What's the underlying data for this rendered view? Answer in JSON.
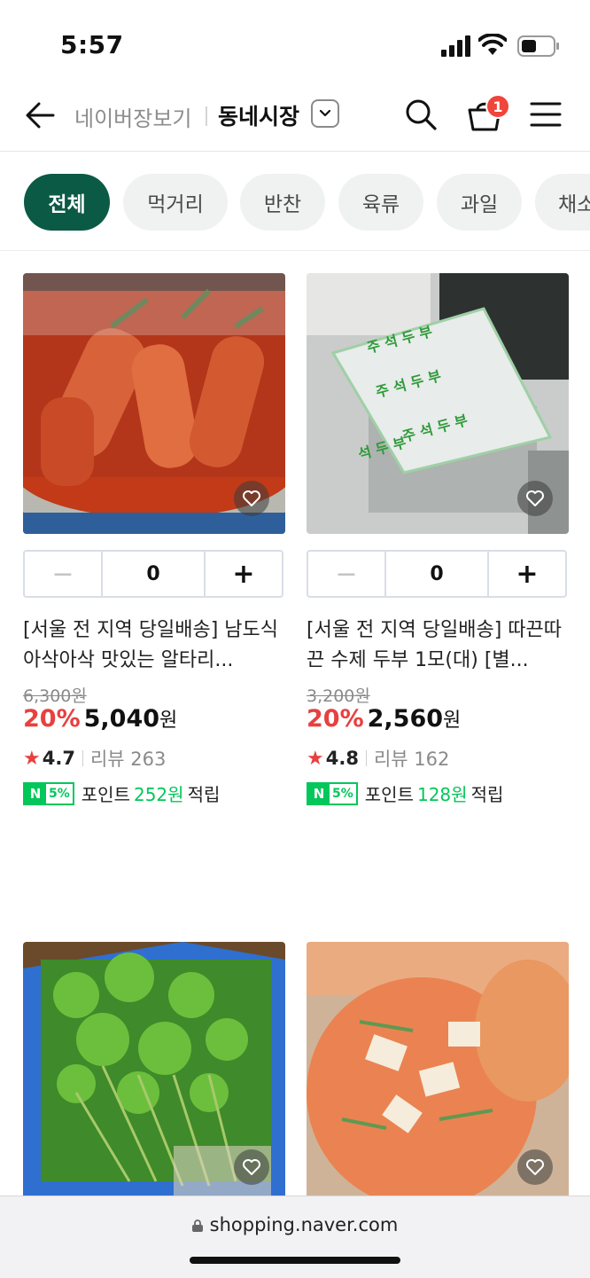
{
  "status": {
    "time": "5:57"
  },
  "header": {
    "brand": "네이버장보기",
    "market": "동네시장",
    "cart_count": "1"
  },
  "chips": [
    "전체",
    "먹거리",
    "반찬",
    "육류",
    "과일",
    "채소"
  ],
  "products": [
    {
      "title": "[서울 전 지역 당일배송] 남도식 아삭아삭 맛있는 알타리...",
      "qty": "0",
      "orig_price": "6,300원",
      "discount": "20%",
      "price": "5,040",
      "won": "원",
      "rating": "4.7",
      "review": "리뷰 263",
      "point_prefix": "포인트",
      "point": "252원",
      "point_suffix": "적립",
      "n_label": "N",
      "pct_label": "5%"
    },
    {
      "title": "[서울 전 지역 당일배송] 따끈따끈 수제 두부 1모(대) [별...",
      "qty": "0",
      "orig_price": "3,200원",
      "discount": "20%",
      "price": "2,560",
      "won": "원",
      "rating": "4.8",
      "review": "리뷰 162",
      "point_prefix": "포인트",
      "point": "128원",
      "point_suffix": "적립",
      "n_label": "N",
      "pct_label": "5%"
    }
  ],
  "url": "shopping.naver.com",
  "colors": {
    "accent": "#0b5a45",
    "discount": "#e84040",
    "naver": "#03c75a",
    "badge": "#f0453a"
  }
}
